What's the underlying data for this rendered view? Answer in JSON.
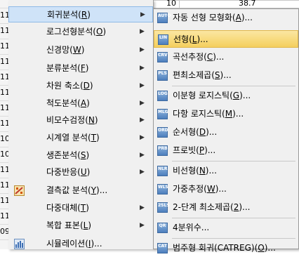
{
  "background": {
    "row_stubs": [
      "",
      "11",
      "11",
      "11",
      "11",
      "11",
      "11",
      "11",
      "11",
      "10",
      "10",
      "11",
      "11",
      "11",
      "11",
      "09"
    ],
    "cell_top_left": "10",
    "cell_top_right": "38.7"
  },
  "left_menu": {
    "items": [
      {
        "label": "회귀분석(",
        "mn": "R",
        "tail": ")",
        "submenu": true,
        "icon": null
      },
      {
        "label": "로그선형분석(",
        "mn": "O",
        "tail": ")",
        "submenu": true,
        "icon": null
      },
      {
        "label": "신경망(",
        "mn": "W",
        "tail": ")",
        "submenu": true,
        "icon": null
      },
      {
        "label": "분류분석(",
        "mn": "F",
        "tail": ")",
        "submenu": true,
        "icon": null
      },
      {
        "label": "차원 축소(",
        "mn": "D",
        "tail": ")",
        "submenu": true,
        "icon": null
      },
      {
        "label": "척도분석(",
        "mn": "A",
        "tail": ")",
        "submenu": true,
        "icon": null
      },
      {
        "label": "비모수검정(",
        "mn": "N",
        "tail": ")",
        "submenu": true,
        "icon": null
      },
      {
        "label": "시계열 분석(",
        "mn": "T",
        "tail": ")",
        "submenu": true,
        "icon": null
      },
      {
        "label": "생존분석(",
        "mn": "S",
        "tail": ")",
        "submenu": true,
        "icon": null
      },
      {
        "label": "다중반응(",
        "mn": "U",
        "tail": ")",
        "submenu": true,
        "icon": null
      },
      {
        "label": "결측값 분석(",
        "mn": "Y",
        "tail": ")...",
        "submenu": false,
        "icon": "missing-values-icon"
      },
      {
        "label": "다중대체(",
        "mn": "T",
        "tail": ")",
        "submenu": true,
        "icon": null
      },
      {
        "label": "복합 표본(",
        "mn": "L",
        "tail": ")",
        "submenu": true,
        "icon": null
      },
      {
        "label": "시뮬레이션(",
        "mn": "I",
        "tail": ")...",
        "submenu": false,
        "icon": "simulation-icon"
      }
    ]
  },
  "submenu": {
    "items": [
      {
        "label": "자동 선형 모형화(",
        "mn": "A",
        "tail": ")...",
        "icon_text": "AUTO"
      },
      {
        "label": "선형(",
        "mn": "L",
        "tail": ")...",
        "icon_text": "LIN",
        "highlighted": true
      },
      {
        "label": "곡선추정(",
        "mn": "C",
        "tail": ")...",
        "icon_text": "CRV"
      },
      {
        "label": "편최소제곱(",
        "mn": "S",
        "tail": ")...",
        "icon_text": "PLS"
      },
      {
        "label": "이분형 로지스틱(",
        "mn": "G",
        "tail": ")...",
        "icon_text": "LOG"
      },
      {
        "label": "다항 로지스틱(",
        "mn": "M",
        "tail": ")...",
        "icon_text": "MLG"
      },
      {
        "label": "순서형(",
        "mn": "D",
        "tail": ")...",
        "icon_text": "ORD"
      },
      {
        "label": "프로빗(",
        "mn": "P",
        "tail": ")...",
        "icon_text": "PRB"
      },
      {
        "label": "비선형(",
        "mn": "N",
        "tail": ")...",
        "icon_text": "NLR"
      },
      {
        "label": "가중추정(",
        "mn": "W",
        "tail": ")...",
        "icon_text": "WLS"
      },
      {
        "label": "2-단계 최소제곱(",
        "mn": "2",
        "tail": ")...",
        "icon_text": "2SLS"
      },
      {
        "label": "4분위수...",
        "mn": "",
        "tail": "",
        "icon_text": "QR"
      },
      {
        "label": "범주형 회귀(CATREG)(",
        "mn": "O",
        "tail": ")...",
        "icon_text": "CAT"
      }
    ]
  },
  "colors": {
    "highlight": "#f4cf5e",
    "active": "#cfe3f8",
    "menu_bg": "#f0f0f0"
  }
}
